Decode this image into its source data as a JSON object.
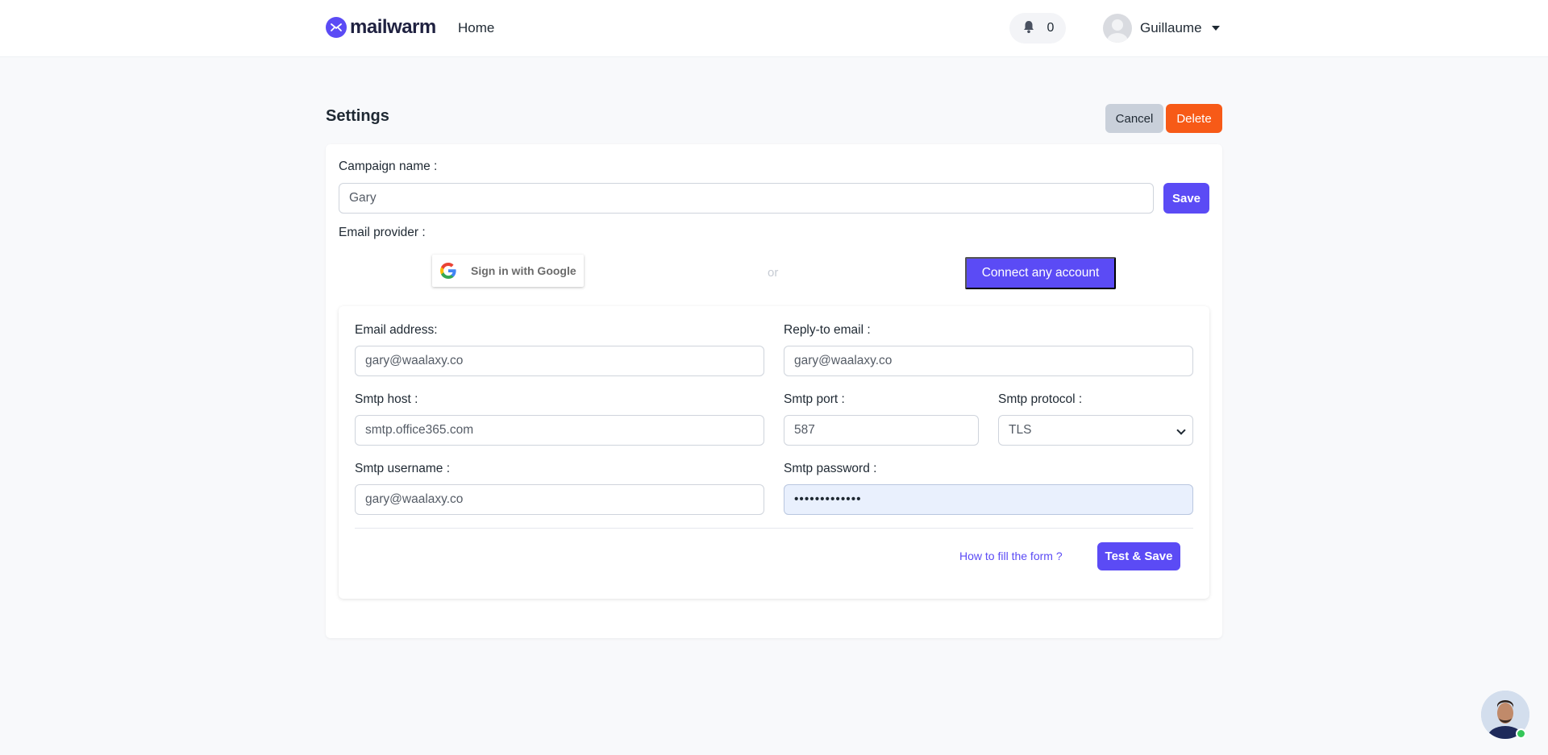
{
  "nav": {
    "brand": "mailwarm",
    "home": "Home",
    "notifications_count": "0",
    "user_name": "Guillaume"
  },
  "settings": {
    "title": "Settings",
    "cancel": "Cancel",
    "delete": "Delete"
  },
  "campaign": {
    "name_label": "Campaign name :",
    "name_value": "Gary",
    "save": "Save",
    "provider_label": "Email provider :",
    "google_signin": "Sign in with Google",
    "or": "or",
    "connect_any": "Connect any account"
  },
  "smtp_form": {
    "email_label": "Email address:",
    "email_value": "gary@waalaxy.co",
    "reply_label": "Reply-to email :",
    "reply_value": "gary@waalaxy.co",
    "host_label": "Smtp host :",
    "host_value": "smtp.office365.com",
    "port_label": "Smtp port :",
    "port_value": "587",
    "protocol_label": "Smtp protocol :",
    "protocol_value": "TLS",
    "username_label": "Smtp username :",
    "username_value": "gary@waalaxy.co",
    "password_label": "Smtp password :",
    "password_value": "•••••••••••••",
    "help_link": "How to fill the form ?",
    "test_save": "Test & Save"
  },
  "colors": {
    "primary": "#5b4bf5",
    "danger": "#f75a17",
    "secondary": "#c9d0da"
  }
}
